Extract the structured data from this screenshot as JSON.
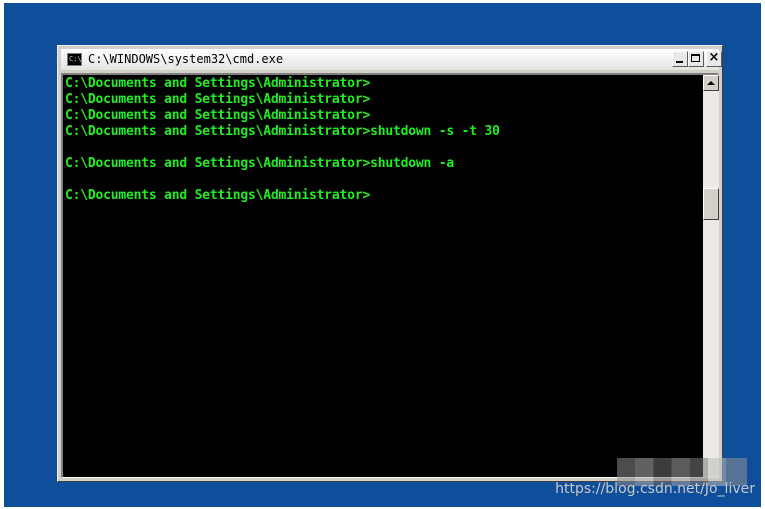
{
  "window": {
    "title": "C:\\WINDOWS\\system32\\cmd.exe",
    "icon": "C:\\",
    "close_glyph": "×"
  },
  "console": {
    "lines": [
      "C:\\Documents and Settings\\Administrator>",
      "C:\\Documents and Settings\\Administrator>",
      "C:\\Documents and Settings\\Administrator>",
      "C:\\Documents and Settings\\Administrator>shutdown -s -t 30",
      "",
      "C:\\Documents and Settings\\Administrator>shutdown -a",
      "",
      "C:\\Documents and Settings\\Administrator>"
    ],
    "text_color": "#20ee20",
    "background": "#000000"
  },
  "desktop": {
    "background": "#0e4e9a"
  },
  "watermark": {
    "text": "https://blog.csdn.net/Jo_liver"
  }
}
